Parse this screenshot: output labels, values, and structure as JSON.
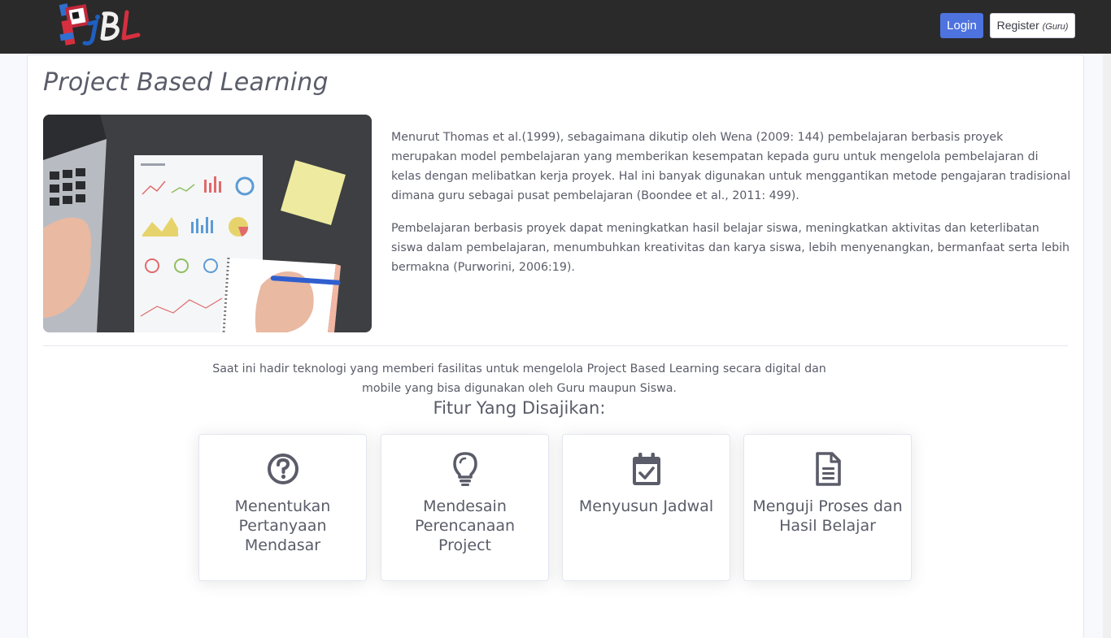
{
  "navbar": {
    "logo_text": "PjBL",
    "login_label": "Login",
    "register_label": "Register",
    "register_sub": "(Guru)"
  },
  "main": {
    "title": "Project Based Learning",
    "paragraphs": [
      "Menurut Thomas et al.(1999), sebagaimana dikutip oleh Wena (2009: 144) pembelajaran berbasis proyek merupakan model pembelajaran yang memberikan kesempatan kepada guru untuk mengelola pembelajaran di kelas dengan melibatkan kerja proyek. Hal ini banyak digunakan untuk menggantikan metode pengajaran tradisional dimana guru sebagai pusat pembelajaran (Boondee et al., 2011: 499).",
      "Pembelajaran berbasis proyek dapat meningkatkan hasil belajar siswa, meningkatkan aktivitas dan keterlibatan siswa dalam pembelajaran, menumbuhkan kreativitas dan karya siswa, lebih menyenangkan, bermanfaat serta lebih bermakna (Purworini, 2006:19)."
    ],
    "lead": "Saat ini hadir teknologi yang memberi fasilitas untuk mengelola Project Based Learning secara digital dan mobile yang bisa digunakan oleh Guru maupun Siswa.",
    "features_title": "Fitur Yang Disajikan:",
    "features": [
      {
        "icon": "question-circle-icon",
        "label": "Menentukan Pertanyaan Mendasar"
      },
      {
        "icon": "lightbulb-icon",
        "label": "Mendesain Perencanaan Project"
      },
      {
        "icon": "calendar-check-icon",
        "label": "Menyusun Jadwal"
      },
      {
        "icon": "file-document-icon",
        "label": "Menguji Proses dan Hasil Belajar"
      }
    ]
  },
  "colors": {
    "navbar_bg": "#2a2a2a",
    "primary": "#4e73df",
    "text": "#5a5c69",
    "icon": "#5a5c69"
  }
}
